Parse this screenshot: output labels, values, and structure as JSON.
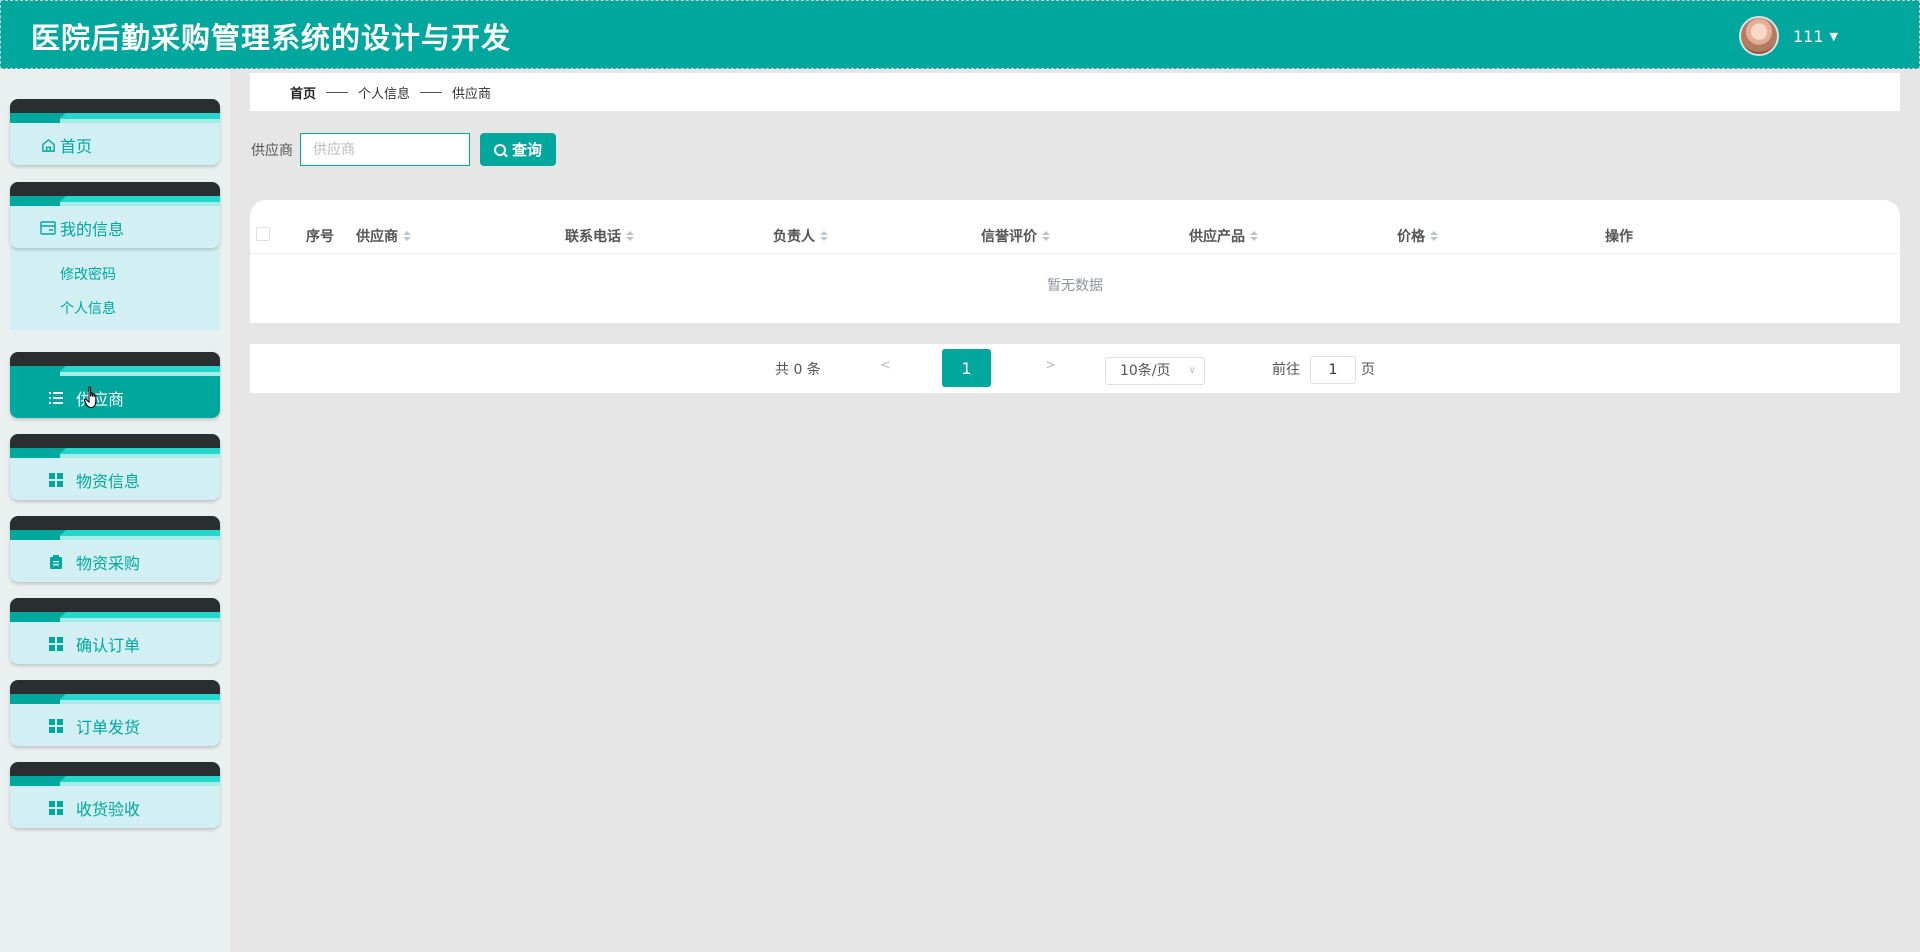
{
  "header": {
    "title": "医院后勤采购管理系统的设计与开发",
    "username": "111"
  },
  "sidebar": {
    "items": [
      {
        "label": "首页",
        "icon": "home-icon"
      },
      {
        "label": "我的信息",
        "icon": "card-icon",
        "children": [
          "修改密码",
          "个人信息"
        ]
      },
      {
        "label": "供应商",
        "icon": "list-icon",
        "active": true
      },
      {
        "label": "物资信息",
        "icon": "grid-icon"
      },
      {
        "label": "物资采购",
        "icon": "clipboard-icon"
      },
      {
        "label": "确认订单",
        "icon": "grid-icon"
      },
      {
        "label": "订单发货",
        "icon": "grid-icon"
      },
      {
        "label": "收货验收",
        "icon": "grid-icon"
      }
    ]
  },
  "breadcrumb": [
    "首页",
    "个人信息",
    "供应商"
  ],
  "search": {
    "label": "供应商",
    "placeholder": "供应商",
    "value": "",
    "button": "查询"
  },
  "table": {
    "columns": [
      "序号",
      "供应商",
      "联系电话",
      "负责人",
      "信誉评价",
      "供应产品",
      "价格",
      "操作"
    ],
    "rows": [],
    "empty_text": "暂无数据"
  },
  "pagination": {
    "total_text": "共 0 条",
    "prev": "<",
    "current_page": "1",
    "next": ">",
    "page_size": "10条/页",
    "goto_label": "前往",
    "goto_value": "1",
    "page_unit": "页"
  },
  "colors": {
    "primary": "#00a79d",
    "sidebar_item_bg": "#d2f0f3",
    "header_bg": "#00a79d"
  }
}
